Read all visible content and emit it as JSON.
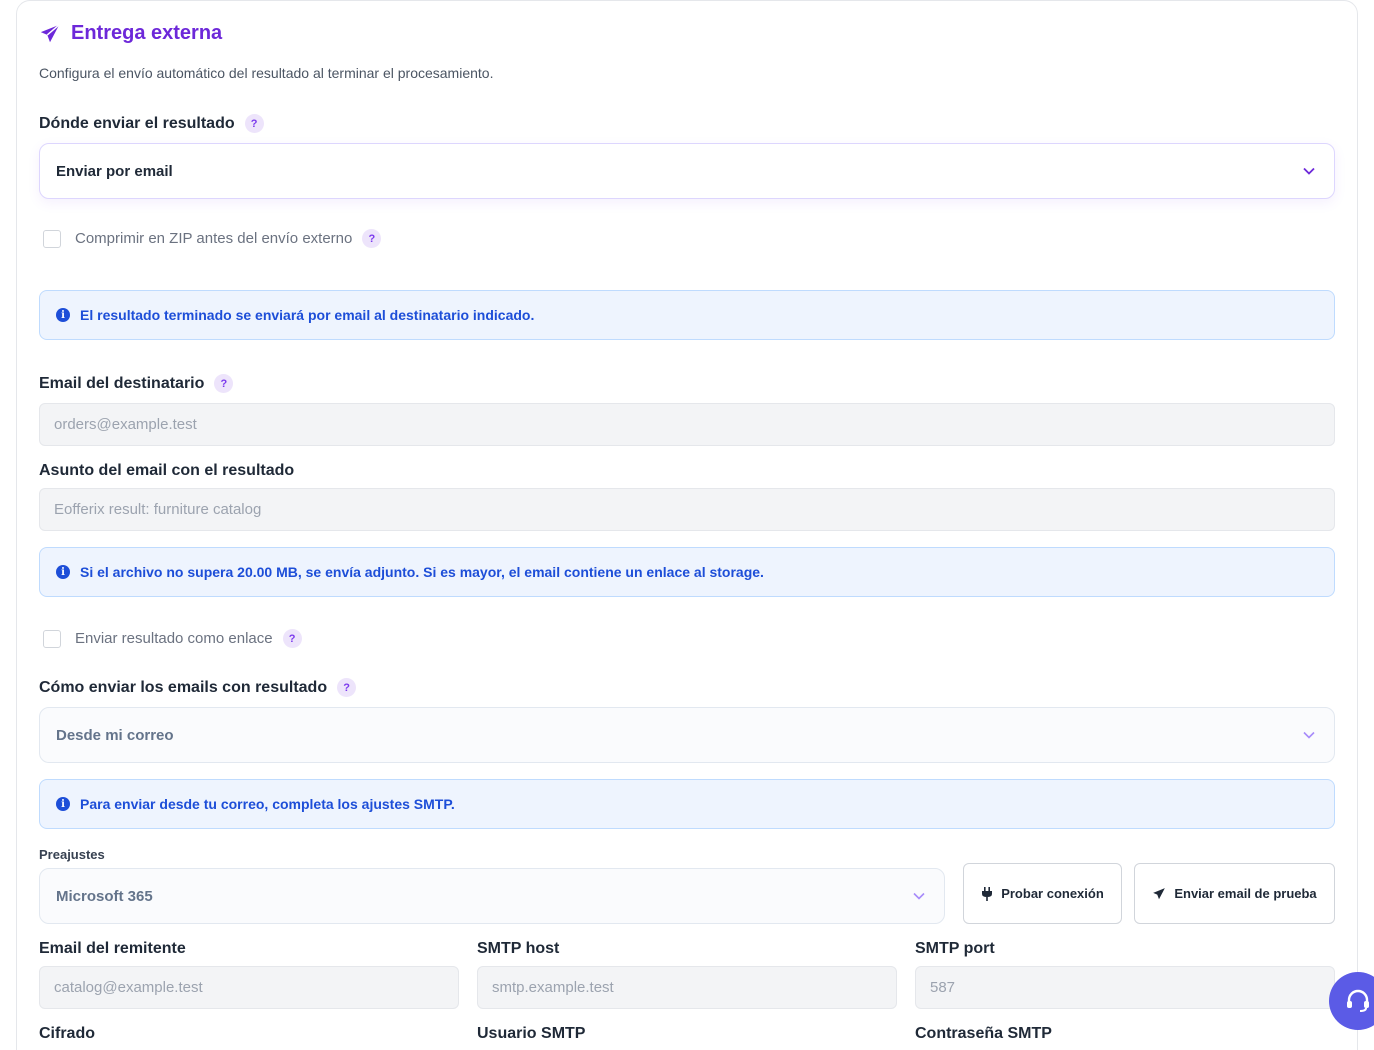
{
  "section": {
    "title": "Entrega externa",
    "subtitle": "Configura el envío automático del resultado al terminar el procesamiento."
  },
  "destination": {
    "label": "Dónde enviar el resultado",
    "help": "?",
    "selected": "Enviar por email"
  },
  "zip": {
    "label": "Comprimir en ZIP antes del envío externo",
    "help": "?",
    "checked": false
  },
  "info_delivery": {
    "text": "El resultado terminado se enviará por email al destinatario indicado.",
    "icon": "i"
  },
  "recipient": {
    "label": "Email del destinatario",
    "help": "?",
    "placeholder": "orders@example.test"
  },
  "subject": {
    "label": "Asunto del email con el resultado",
    "placeholder": "Eofferix result: furniture catalog"
  },
  "info_size": {
    "text": "Si el archivo no supera 20.00 MB, se envía adjunto. Si es mayor, el email contiene un enlace al storage.",
    "icon": "i"
  },
  "as_link": {
    "label": "Enviar resultado como enlace",
    "help": "?",
    "checked": false
  },
  "send_method": {
    "label": "Cómo enviar los emails con resultado",
    "help": "?",
    "selected": "Desde mi correo"
  },
  "info_smtp": {
    "text": "Para enviar desde tu correo, completa los ajustes SMTP.",
    "icon": "i"
  },
  "presets": {
    "label": "Preajustes",
    "selected": "Microsoft 365"
  },
  "buttons": {
    "test_connection": "Probar conexión",
    "send_test_email": "Enviar email de prueba"
  },
  "smtp": {
    "sender_label": "Email del remitente",
    "sender_placeholder": "catalog@example.test",
    "host_label": "SMTP host",
    "host_placeholder": "smtp.example.test",
    "port_label": "SMTP port",
    "port_placeholder": "587",
    "encryption_label": "Cifrado",
    "user_label": "Usuario SMTP",
    "password_label": "Contraseña SMTP"
  },
  "colors": {
    "accent": "#6d28d9",
    "info_text": "#1d4ed8",
    "info_bg": "#eef4fe",
    "fab": "#5b5be6"
  }
}
